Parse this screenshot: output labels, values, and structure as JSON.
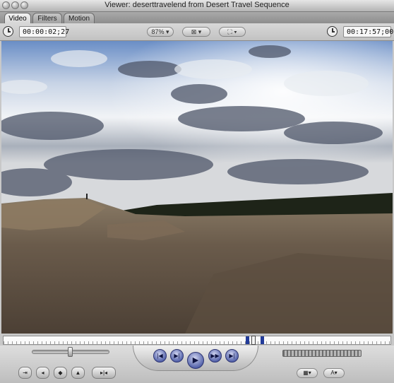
{
  "window": {
    "title": "Viewer: deserttravelend from Desert Travel Sequence"
  },
  "tabs": [
    {
      "label": "Video",
      "active": true
    },
    {
      "label": "Filters",
      "active": false
    },
    {
      "label": "Motion",
      "active": false
    }
  ],
  "toolbar": {
    "current_timecode": "00:00:02;27",
    "zoom_label": "87%",
    "view_icon": "overlay-menu-icon",
    "composite_icon": "frame-menu-icon",
    "duration_timecode": "00:17:57;00"
  },
  "scrubber": {
    "playhead_fraction": 0.64
  },
  "transport": {
    "shuttle_level": 0.5,
    "buttons": {
      "previous_edit": "previous-edit-icon",
      "play_in_to_out": "play-in-to-out-icon",
      "play": "play-icon",
      "play_around": "play-around-icon",
      "next_edit": "next-edit-icon"
    },
    "markers": {
      "insert": "insert-clip-icon",
      "mark_in": "mark-in-icon",
      "add_marker": "add-marker-icon",
      "mark_clip": "mark-clip-icon",
      "mark_in_out": "mark-in-out-icon"
    },
    "right_menus": [
      "generator-menu-icon",
      "text-menu-icon"
    ]
  },
  "colors": {
    "accent_blue": "#233c9a",
    "transport_blue": "#4f5ea8"
  }
}
